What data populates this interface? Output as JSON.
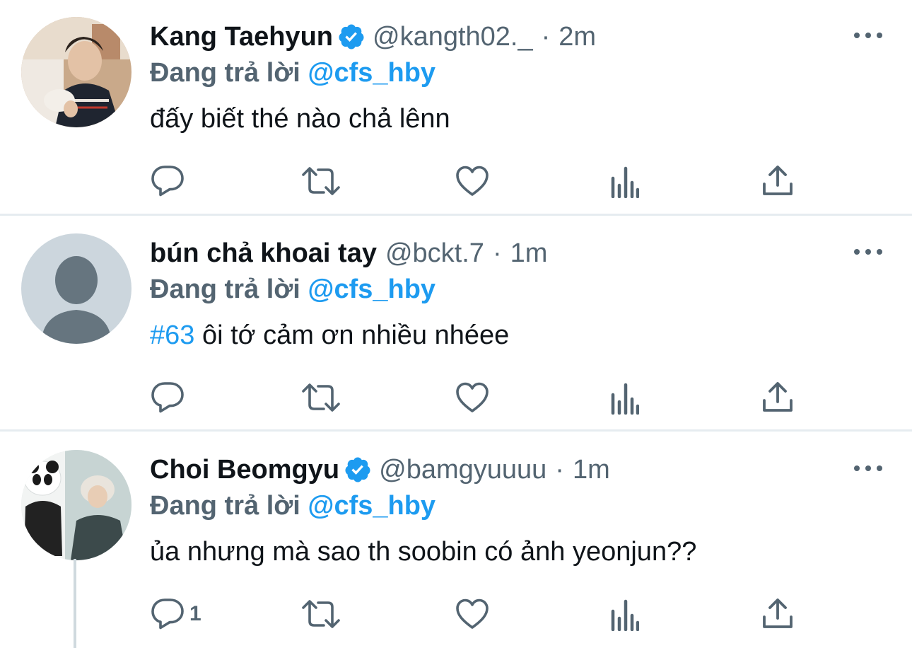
{
  "tweets": [
    {
      "name": "Kang Taehyun",
      "verified": true,
      "handle": "@kangth02._",
      "separator": "·",
      "time": "2m",
      "reply_prefix": "Đang trả lời",
      "reply_to": "@cfs_hby",
      "hashtag": "",
      "text": "đấy biết thé nào chả lênn",
      "reply_count": ""
    },
    {
      "name": "bún chả khoai tay",
      "verified": false,
      "handle": "@bckt.7",
      "separator": "·",
      "time": "1m",
      "reply_prefix": "Đang trả lời",
      "reply_to": "@cfs_hby",
      "hashtag": "#63",
      "text": " ôi tớ cảm ơn nhiều nhéee",
      "reply_count": ""
    },
    {
      "name": "Choi Beomgyu",
      "verified": true,
      "handle": "@bamgyuuuu",
      "separator": "·",
      "time": "1m",
      "reply_prefix": "Đang trả lời",
      "reply_to": "@cfs_hby",
      "hashtag": "",
      "text": "ủa nhưng mà sao th soobin có ảnh yeonjun??",
      "reply_count": "1"
    }
  ],
  "icons": {
    "reply": "reply-icon",
    "retweet": "retweet-icon",
    "like": "heart-icon",
    "views": "views-icon",
    "share": "share-icon",
    "more": "more-icon",
    "verified": "verified-badge-icon"
  },
  "colors": {
    "accent": "#1d9bf0",
    "muted": "#536471",
    "text": "#0f1419",
    "divider": "#e6ecf0"
  }
}
